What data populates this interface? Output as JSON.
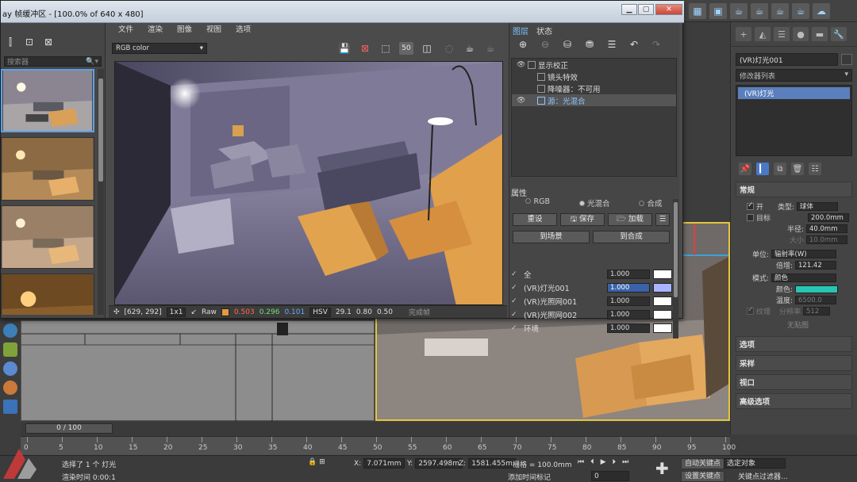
{
  "vfb": {
    "title": "ay 帧缓冲区 - [100.0% of 640 x 480]",
    "menus": [
      "文件",
      "渲染",
      "图像",
      "视图",
      "选项"
    ],
    "channel": "RGB color",
    "history_search_placeholder": "搜索器",
    "status": {
      "coords": "[629, 292]",
      "zoom": "1x1",
      "mode": "Raw",
      "r": "0.503",
      "g": "0.296",
      "b": "0.101",
      "colorspace": "HSV",
      "v1": "29.1",
      "v2": "0.80",
      "v3": "0.50",
      "state": "完成帧"
    }
  },
  "layers_panel": {
    "tabs": [
      "图层",
      "状态"
    ],
    "tree": [
      {
        "label": "显示校正",
        "eye": true
      },
      {
        "label": "镜头特效",
        "eye": false
      },
      {
        "label": "降噪器：不可用",
        "eye": false
      },
      {
        "label": "源：光混合",
        "eye": true,
        "selected": true
      }
    ],
    "properties_title": "属性",
    "blend_modes": [
      {
        "label": "RGB",
        "on": false
      },
      {
        "label": "光混合",
        "on": true
      },
      {
        "label": "合成",
        "on": false
      }
    ],
    "buttons_row1": [
      "重设",
      "保存",
      "加载"
    ],
    "buttons_row2": [
      "到场景",
      "到合成"
    ],
    "blend_rows": [
      {
        "name": "全",
        "value": "1.000",
        "color": "#ffffff",
        "editing": false
      },
      {
        "name": "(VR)灯光001",
        "value": "1.000",
        "color": "#a9b5ff",
        "editing": true
      },
      {
        "name": "(VR)光照网001",
        "value": "1.000",
        "color": "#ffffff",
        "editing": false
      },
      {
        "name": "(VR)光照网002",
        "value": "1.000",
        "color": "#ffffff",
        "editing": false
      },
      {
        "name": "环境",
        "value": "1.000",
        "color": "#ffffff",
        "editing": false
      }
    ]
  },
  "command_panel": {
    "object_name": "(VR)灯光001",
    "modifier_list": "修改器列表",
    "stack_item": "(VR)灯光",
    "rollouts": {
      "general": "常规",
      "options": "选项",
      "sampling": "采样",
      "viewport": "视口",
      "advanced": "高级选项"
    },
    "general": {
      "on_label": "开",
      "type_label": "类型:",
      "type_value": "球体",
      "target_label": "目标",
      "target_value": "200.0mm",
      "radius_label": "半径:",
      "radius_value": "40.0mm",
      "size_label": "大小",
      "size_value": "10.0mm",
      "unit_label": "单位:",
      "unit_value": "辐射率(W)",
      "mult_label": "倍增:",
      "mult_value": "121.42",
      "mode_label": "模式:",
      "mode_value": "颜色",
      "color_label": "颜色:",
      "temp_label": "温度:",
      "temp_value": "6500.0",
      "texture_label": "纹理",
      "res_label": "分辨率",
      "res_value": "512",
      "map_none": "无贴图"
    }
  },
  "timeline": {
    "slider": "0 / 100",
    "ticks": [
      "0",
      "5",
      "10",
      "15",
      "20",
      "25",
      "30",
      "35",
      "40",
      "45",
      "50",
      "55",
      "60",
      "65",
      "70",
      "75",
      "80",
      "85",
      "90",
      "95",
      "100"
    ]
  },
  "statusbar": {
    "prompt1": "选择了 1 个 灯光",
    "prompt2": "渲染时间 0:00:1",
    "x_label": "X:",
    "x_value": "7.071mm",
    "y_label": "Y:",
    "y_value": "2597.498m",
    "z_label": "Z:",
    "z_value": "1581.455m",
    "grid_label": "栅格 = 100.0mm",
    "add_time_tag": "添加时间标记",
    "auto_key": "自动关键点",
    "set_key": "设置关键点",
    "selection_set": "选定对象",
    "key_filters": "关键点过滤器...",
    "frame": "0"
  },
  "colors": {
    "accent": "#5ca0e6",
    "viewport_border": "#e3c640",
    "teal_swatch": "#26c6b2"
  }
}
